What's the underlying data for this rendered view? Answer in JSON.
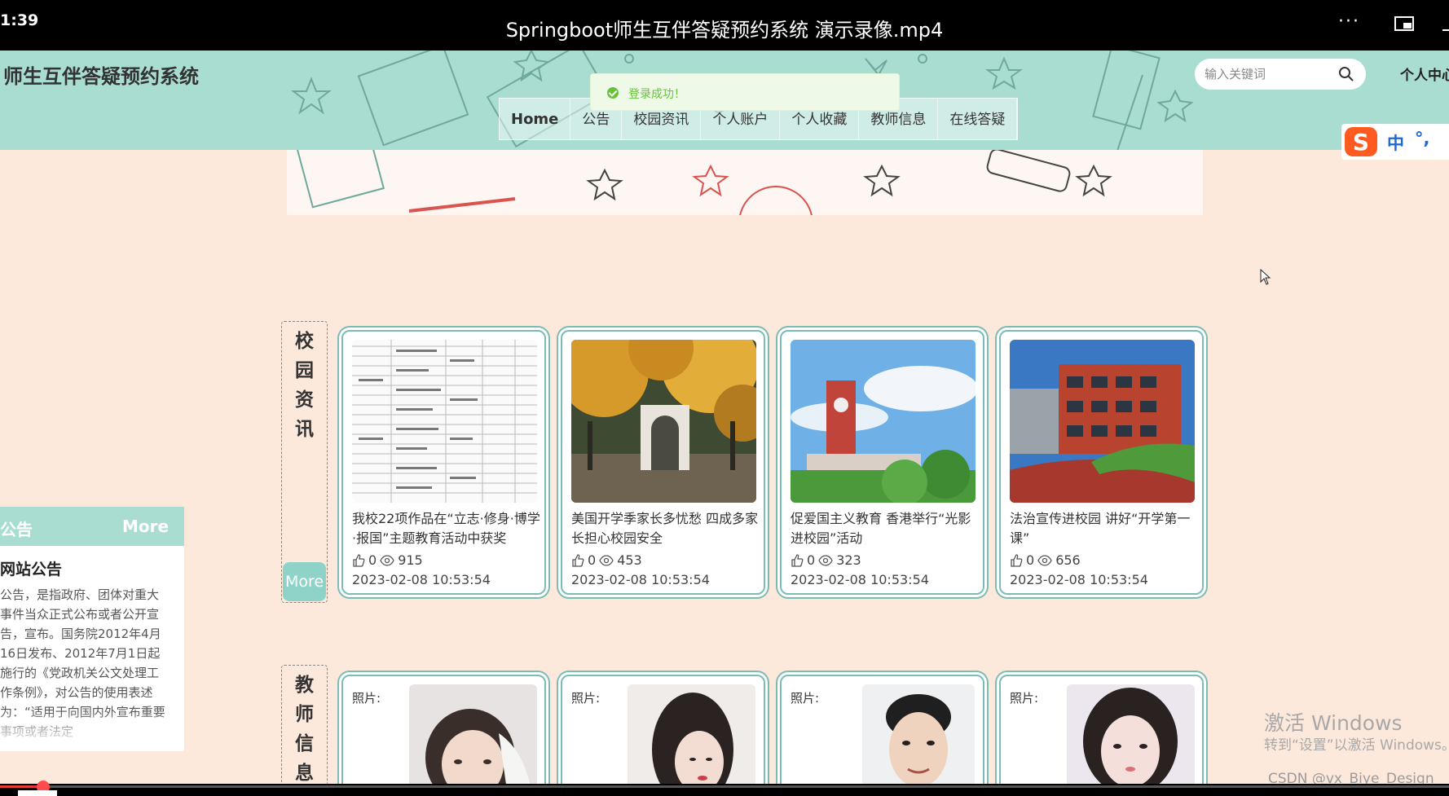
{
  "player": {
    "time": "1:39",
    "title": "Springboot师生互伴答疑预约系统 演示录像.mp4",
    "more_label": "···",
    "progress_percent": 3
  },
  "site": {
    "title": "师生互伴答疑预约系统",
    "search_placeholder": "输入关键词",
    "user_center": "个人中心",
    "nav": [
      "Home",
      "公告",
      "校园资讯",
      "个人账户",
      "个人收藏",
      "教师信息",
      "在线答疑"
    ]
  },
  "toast": {
    "text": "登录成功！"
  },
  "ime": {
    "mode": "中",
    "punct": "°,"
  },
  "notice": {
    "header": "公告",
    "more": "More",
    "title": "网站公告",
    "body": "公告，是指政府、团体对重大事件当众正式公布或者公开宣告，宣布。国务院2012年4月16日发布、2012年7月1日起施行的《党政机关公文处理工作条例》，对公告的使用表述为：“适用于向国内外宣布重要事项或者法定"
  },
  "news_section": {
    "label": "校园资讯",
    "more": "More",
    "items": [
      {
        "title": "我校22项作品在“立志·修身·博学·报国”主题教育活动中获奖",
        "likes": "0",
        "views": "915",
        "date": "2023-02-08 10:53:54"
      },
      {
        "title": "美国开学季家长多忧愁 四成多家长担心校园安全",
        "likes": "0",
        "views": "453",
        "date": "2023-02-08 10:53:54"
      },
      {
        "title": "促爱国主义教育 香港举行“光影进校园”活动",
        "likes": "0",
        "views": "323",
        "date": "2023-02-08 10:53:54"
      },
      {
        "title": "法治宣传进校园 讲好“开学第一课”",
        "likes": "0",
        "views": "656",
        "date": "2023-02-08 10:53:54"
      }
    ]
  },
  "teacher_section": {
    "label": "教师信息",
    "items": [
      {
        "photo_label": "照片:"
      },
      {
        "photo_label": "照片:"
      },
      {
        "photo_label": "照片:"
      },
      {
        "photo_label": "照片:"
      }
    ]
  },
  "watermark": {
    "line1": "激活 Windows",
    "line2": "转到“设置”以激活 Windows。",
    "csdn": "CSDN @vx_Biye_Design_"
  },
  "colors": {
    "header_teal": "#a9ddd2",
    "page_bg": "#fde9dc",
    "card_border": "#7bbcb4",
    "success_green": "#67c23a"
  }
}
